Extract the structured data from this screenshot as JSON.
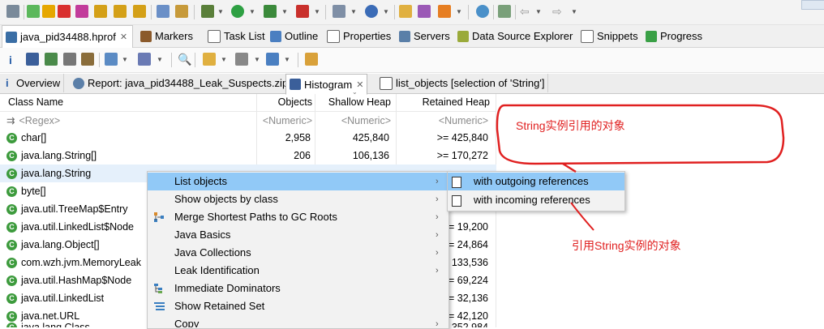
{
  "view_tabs": [
    {
      "label": "java_pid34488.hprof",
      "active": true
    },
    {
      "label": "Markers"
    },
    {
      "label": "Task List"
    },
    {
      "label": "Outline"
    },
    {
      "label": "Properties"
    },
    {
      "label": "Servers"
    },
    {
      "label": "Data Source Explorer"
    },
    {
      "label": "Snippets"
    },
    {
      "label": "Progress"
    }
  ],
  "editor_tabs": [
    {
      "label": "Overview"
    },
    {
      "label": "Report: java_pid34488_Leak_Suspects.zip"
    },
    {
      "label": "Histogram",
      "active": true
    },
    {
      "label": "list_objects [selection of 'String']"
    }
  ],
  "table": {
    "headers": [
      "Class Name",
      "Objects",
      "Shallow Heap",
      "Retained Heap"
    ],
    "filter_row": [
      "<Regex>",
      "<Numeric>",
      "<Numeric>",
      "<Numeric>"
    ],
    "rows": [
      {
        "name": "char[]",
        "objects": "2,958",
        "shallow": "425,840",
        "retained": ">= 425,840"
      },
      {
        "name": "java.lang.String[]",
        "objects": "206",
        "shallow": "106,136",
        "retained": ">= 170,272"
      },
      {
        "name": "java.lang.String",
        "objects": "",
        "shallow": "",
        "retained": ""
      },
      {
        "name": "byte[]",
        "objects": "",
        "shallow": "",
        "retained": ""
      },
      {
        "name": "java.util.TreeMap$Entry",
        "objects": "",
        "shallow": "",
        "retained": ""
      },
      {
        "name": "java.util.LinkedList$Node",
        "objects": "",
        "shallow": "",
        "retained": "= 19,200"
      },
      {
        "name": "java.lang.Object[]",
        "objects": "",
        "shallow": "",
        "retained": "= 24,864"
      },
      {
        "name": "com.wzh.jvm.MemoryLeak",
        "objects": "",
        "shallow": "",
        "retained": "133,536"
      },
      {
        "name": "java.util.HashMap$Node",
        "objects": "",
        "shallow": "",
        "retained": "= 69,224"
      },
      {
        "name": "java.util.LinkedList",
        "objects": "",
        "shallow": "",
        "retained": "= 32,136"
      },
      {
        "name": "java.net.URL",
        "objects": "",
        "shallow": "",
        "retained": "= 42,120"
      },
      {
        "name": "java.lang.Class",
        "objects": "",
        "shallow": "",
        "retained": "352,984"
      }
    ]
  },
  "context_menu": {
    "items": [
      {
        "label": "List objects",
        "submenu": true,
        "highlighted": true
      },
      {
        "label": "Show objects by class",
        "submenu": true
      },
      {
        "label": "Merge Shortest Paths to GC Roots",
        "submenu": true
      },
      {
        "label": "Java Basics",
        "submenu": true
      },
      {
        "label": "Java Collections",
        "submenu": true
      },
      {
        "label": "Leak Identification",
        "submenu": true
      },
      {
        "label": "Immediate Dominators"
      },
      {
        "label": "Show Retained Set"
      },
      {
        "label": "Copy",
        "submenu": true
      }
    ]
  },
  "submenu": {
    "items": [
      {
        "label": "with outgoing references",
        "highlighted": true
      },
      {
        "label": "with incoming references"
      }
    ]
  },
  "annotations": {
    "top": "String实例引用的对象",
    "bottom": "引用String实例的对象"
  },
  "colors": {
    "annotation": "#e02020",
    "menu_highlight": "#91c9f7",
    "class_icon": "#3d9b3d"
  }
}
